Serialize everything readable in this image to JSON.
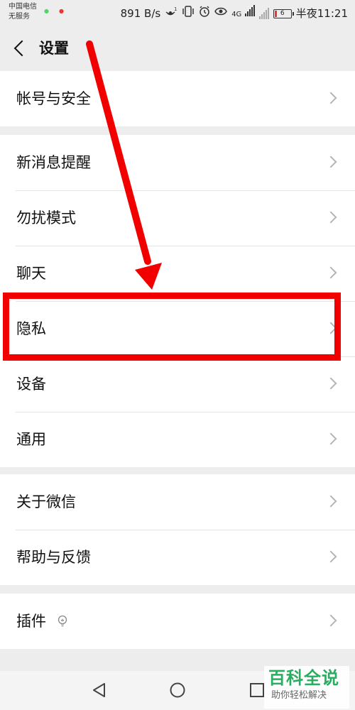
{
  "status_bar": {
    "carrier_line1": "中国电信",
    "carrier_line2": "无服务",
    "net_speed": "891 B/s",
    "battery_level": "6",
    "time": "半夜11:21",
    "icons": [
      "hotspot-icon",
      "vibrate-icon",
      "alarm-icon",
      "eye-icon",
      "signal-4g-icon",
      "signal-icon",
      "battery-icon"
    ],
    "network_label": "4G"
  },
  "header": {
    "title": "设置",
    "back_icon": "chevron-left-icon"
  },
  "groups": [
    {
      "items": [
        {
          "label": "帐号与安全"
        }
      ]
    },
    {
      "items": [
        {
          "label": "新消息提醒"
        },
        {
          "label": "勿扰模式"
        },
        {
          "label": "聊天"
        },
        {
          "label": "隐私"
        },
        {
          "label": "设备"
        },
        {
          "label": "通用"
        }
      ]
    },
    {
      "items": [
        {
          "label": "关于微信"
        },
        {
          "label": "帮助与反馈"
        }
      ]
    },
    {
      "items": [
        {
          "label": "插件",
          "icon": "lightbulb-icon"
        }
      ]
    }
  ],
  "annotation": {
    "highlighted_item": "隐私",
    "color": "#f20000"
  },
  "nav_bar": {
    "icons": [
      "triangle-back-icon",
      "circle-home-icon",
      "square-recent-icon"
    ]
  },
  "watermark": {
    "main": "百科全说",
    "sub": "助你轻松解决",
    "color": "#27ae60"
  },
  "colors": {
    "background": "#ededed",
    "row_background": "#ffffff",
    "chevron": "#b5b5b5"
  }
}
